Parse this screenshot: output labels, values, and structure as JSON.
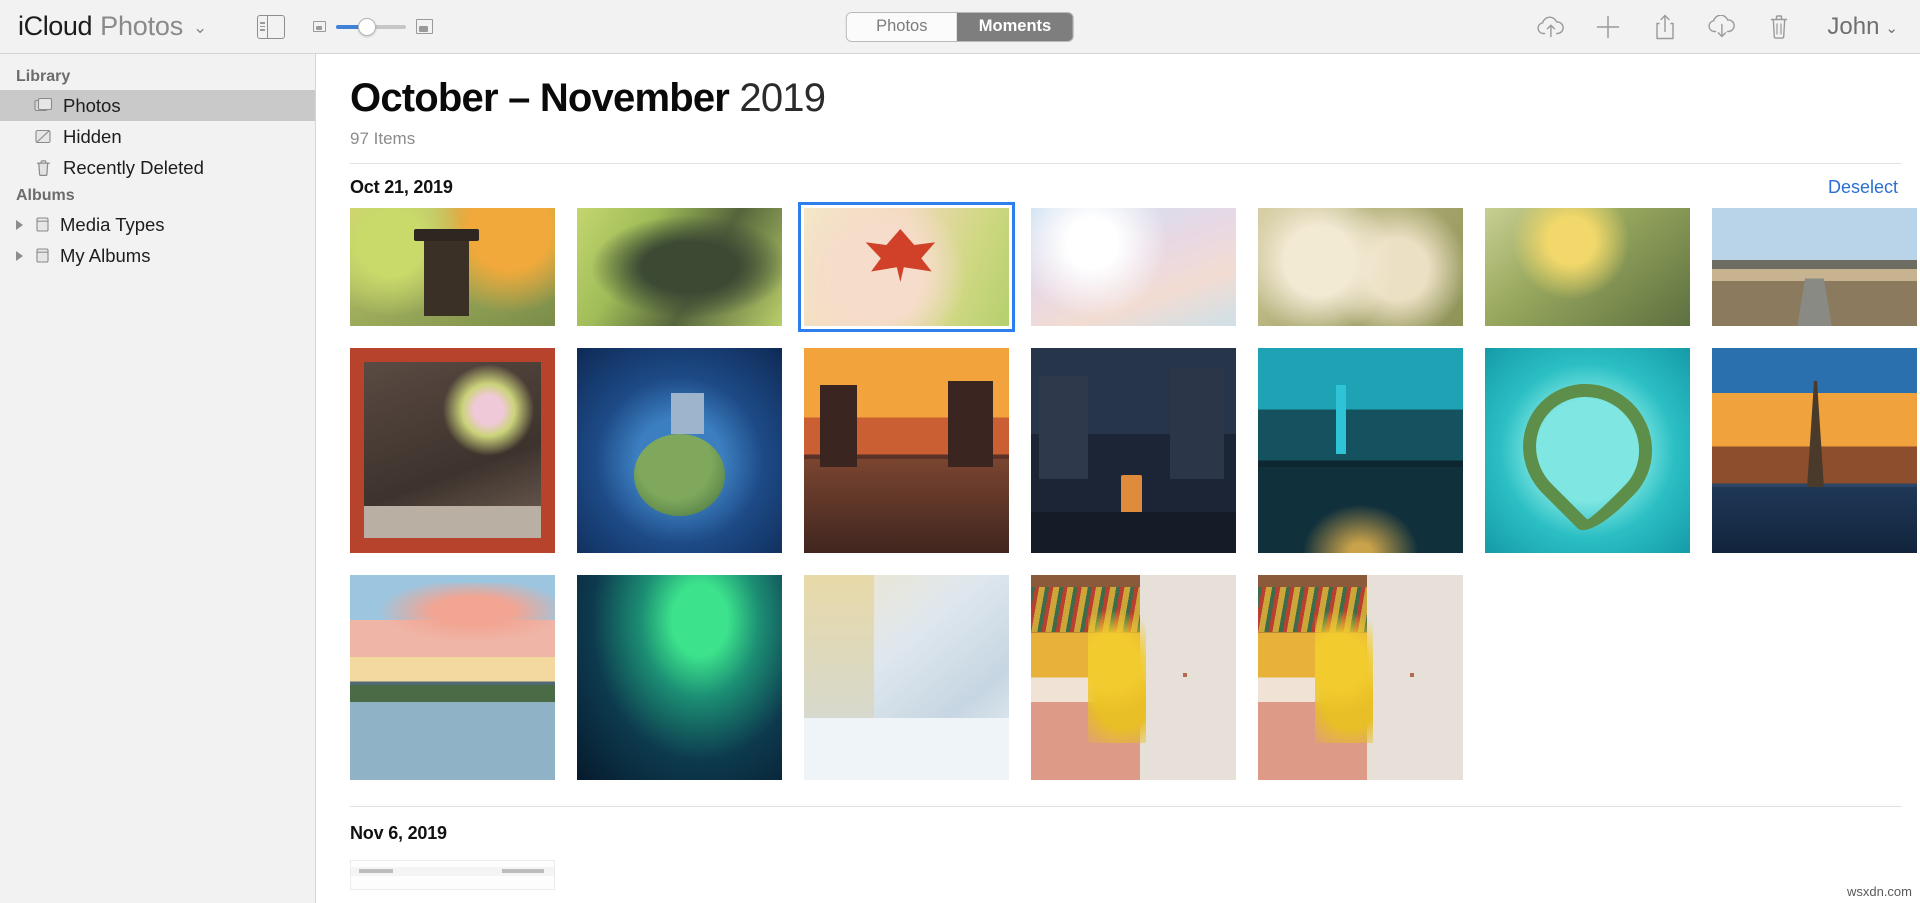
{
  "toolbar": {
    "brand_primary": "iCloud",
    "brand_secondary": "Photos",
    "brand_caret": "⌄",
    "sidebar_toggle_name": "sidebar-toggle",
    "zoom_small_label": "small-thumbnails",
    "zoom_large_label": "large-thumbnails",
    "zoom_value": 42,
    "segments": [
      {
        "label": "Photos",
        "active": false
      },
      {
        "label": "Moments",
        "active": true
      }
    ],
    "icons": [
      "cloud-upload-icon",
      "add-plus-icon",
      "share-icon",
      "cloud-download-icon",
      "trash-icon"
    ],
    "user_name": "John",
    "user_caret": "⌄"
  },
  "sidebar": {
    "groups": [
      {
        "title": "Library",
        "items": [
          {
            "label": "Photos",
            "icon": "photos-stack-icon",
            "selected": true
          },
          {
            "label": "Hidden",
            "icon": "hidden-eye-slash-icon",
            "selected": false
          },
          {
            "label": "Recently Deleted",
            "icon": "trash-icon",
            "selected": false
          }
        ]
      },
      {
        "title": "Albums",
        "items": [
          {
            "label": "Media Types",
            "icon": "album-folder-icon",
            "selected": false,
            "expandable": true
          },
          {
            "label": "My Albums",
            "icon": "album-folder-icon",
            "selected": false,
            "expandable": true
          }
        ]
      }
    ]
  },
  "main": {
    "title_bold": "October – November",
    "title_year": "2019",
    "item_count": "97 Items",
    "sections": [
      {
        "date": "Oct 21, 2019",
        "action_label": "Deselect",
        "rows": [
          {
            "shape": "land",
            "photos": [
              {
                "alt": "wooden-birdhouse-autumn",
                "selected": false
              },
              {
                "alt": "mossy-tree-trunk-autumn-leaves",
                "selected": false
              },
              {
                "alt": "hand-holding-red-maple-leaf",
                "selected": true
              },
              {
                "alt": "soft-pastel-sky-bokeh",
                "selected": false
              },
              {
                "alt": "white-cream-roses",
                "selected": false
              },
              {
                "alt": "yellow-rose-bud-garden",
                "selected": false
              },
              {
                "alt": "desert-highway-mountains",
                "selected": false
              }
            ]
          },
          {
            "shape": "sq",
            "photos": [
              {
                "alt": "cherry-blossom-red-window",
                "selected": false
              },
              {
                "alt": "tiny-planet-castle-clouds",
                "selected": false
              },
              {
                "alt": "palm-street-sunset-road",
                "selected": false
              },
              {
                "alt": "night-city-street-lights",
                "selected": false
              },
              {
                "alt": "teal-city-skyline-night",
                "selected": false
              },
              {
                "alt": "heart-shaped-island-lagoon",
                "selected": false
              },
              {
                "alt": "eiffel-tower-sunset-reflection",
                "selected": false
              }
            ]
          },
          {
            "shape": "sq",
            "photos": [
              {
                "alt": "pink-clouds-lake-reflection",
                "selected": false
              },
              {
                "alt": "green-aurora-borealis-stars",
                "selected": false
              },
              {
                "alt": "snowy-winter-forest-stream",
                "selected": false
              },
              {
                "alt": "yellow-ginkgo-temple-wall",
                "selected": false
              },
              {
                "alt": "yellow-ginkgo-temple-wall-duplicate",
                "selected": false
              }
            ]
          }
        ]
      },
      {
        "date": "Nov 6, 2019",
        "action_label": "",
        "rows": []
      }
    ]
  },
  "watermark": "wsxdn.com",
  "colors": {
    "accent_blue": "#2b6fd4",
    "selection_blue": "#2d7ff0",
    "toolbar_bg": "#f2f2f2",
    "sidebar_selected": "#c9c9c9",
    "segment_active_bg": "#7e7e7e"
  }
}
